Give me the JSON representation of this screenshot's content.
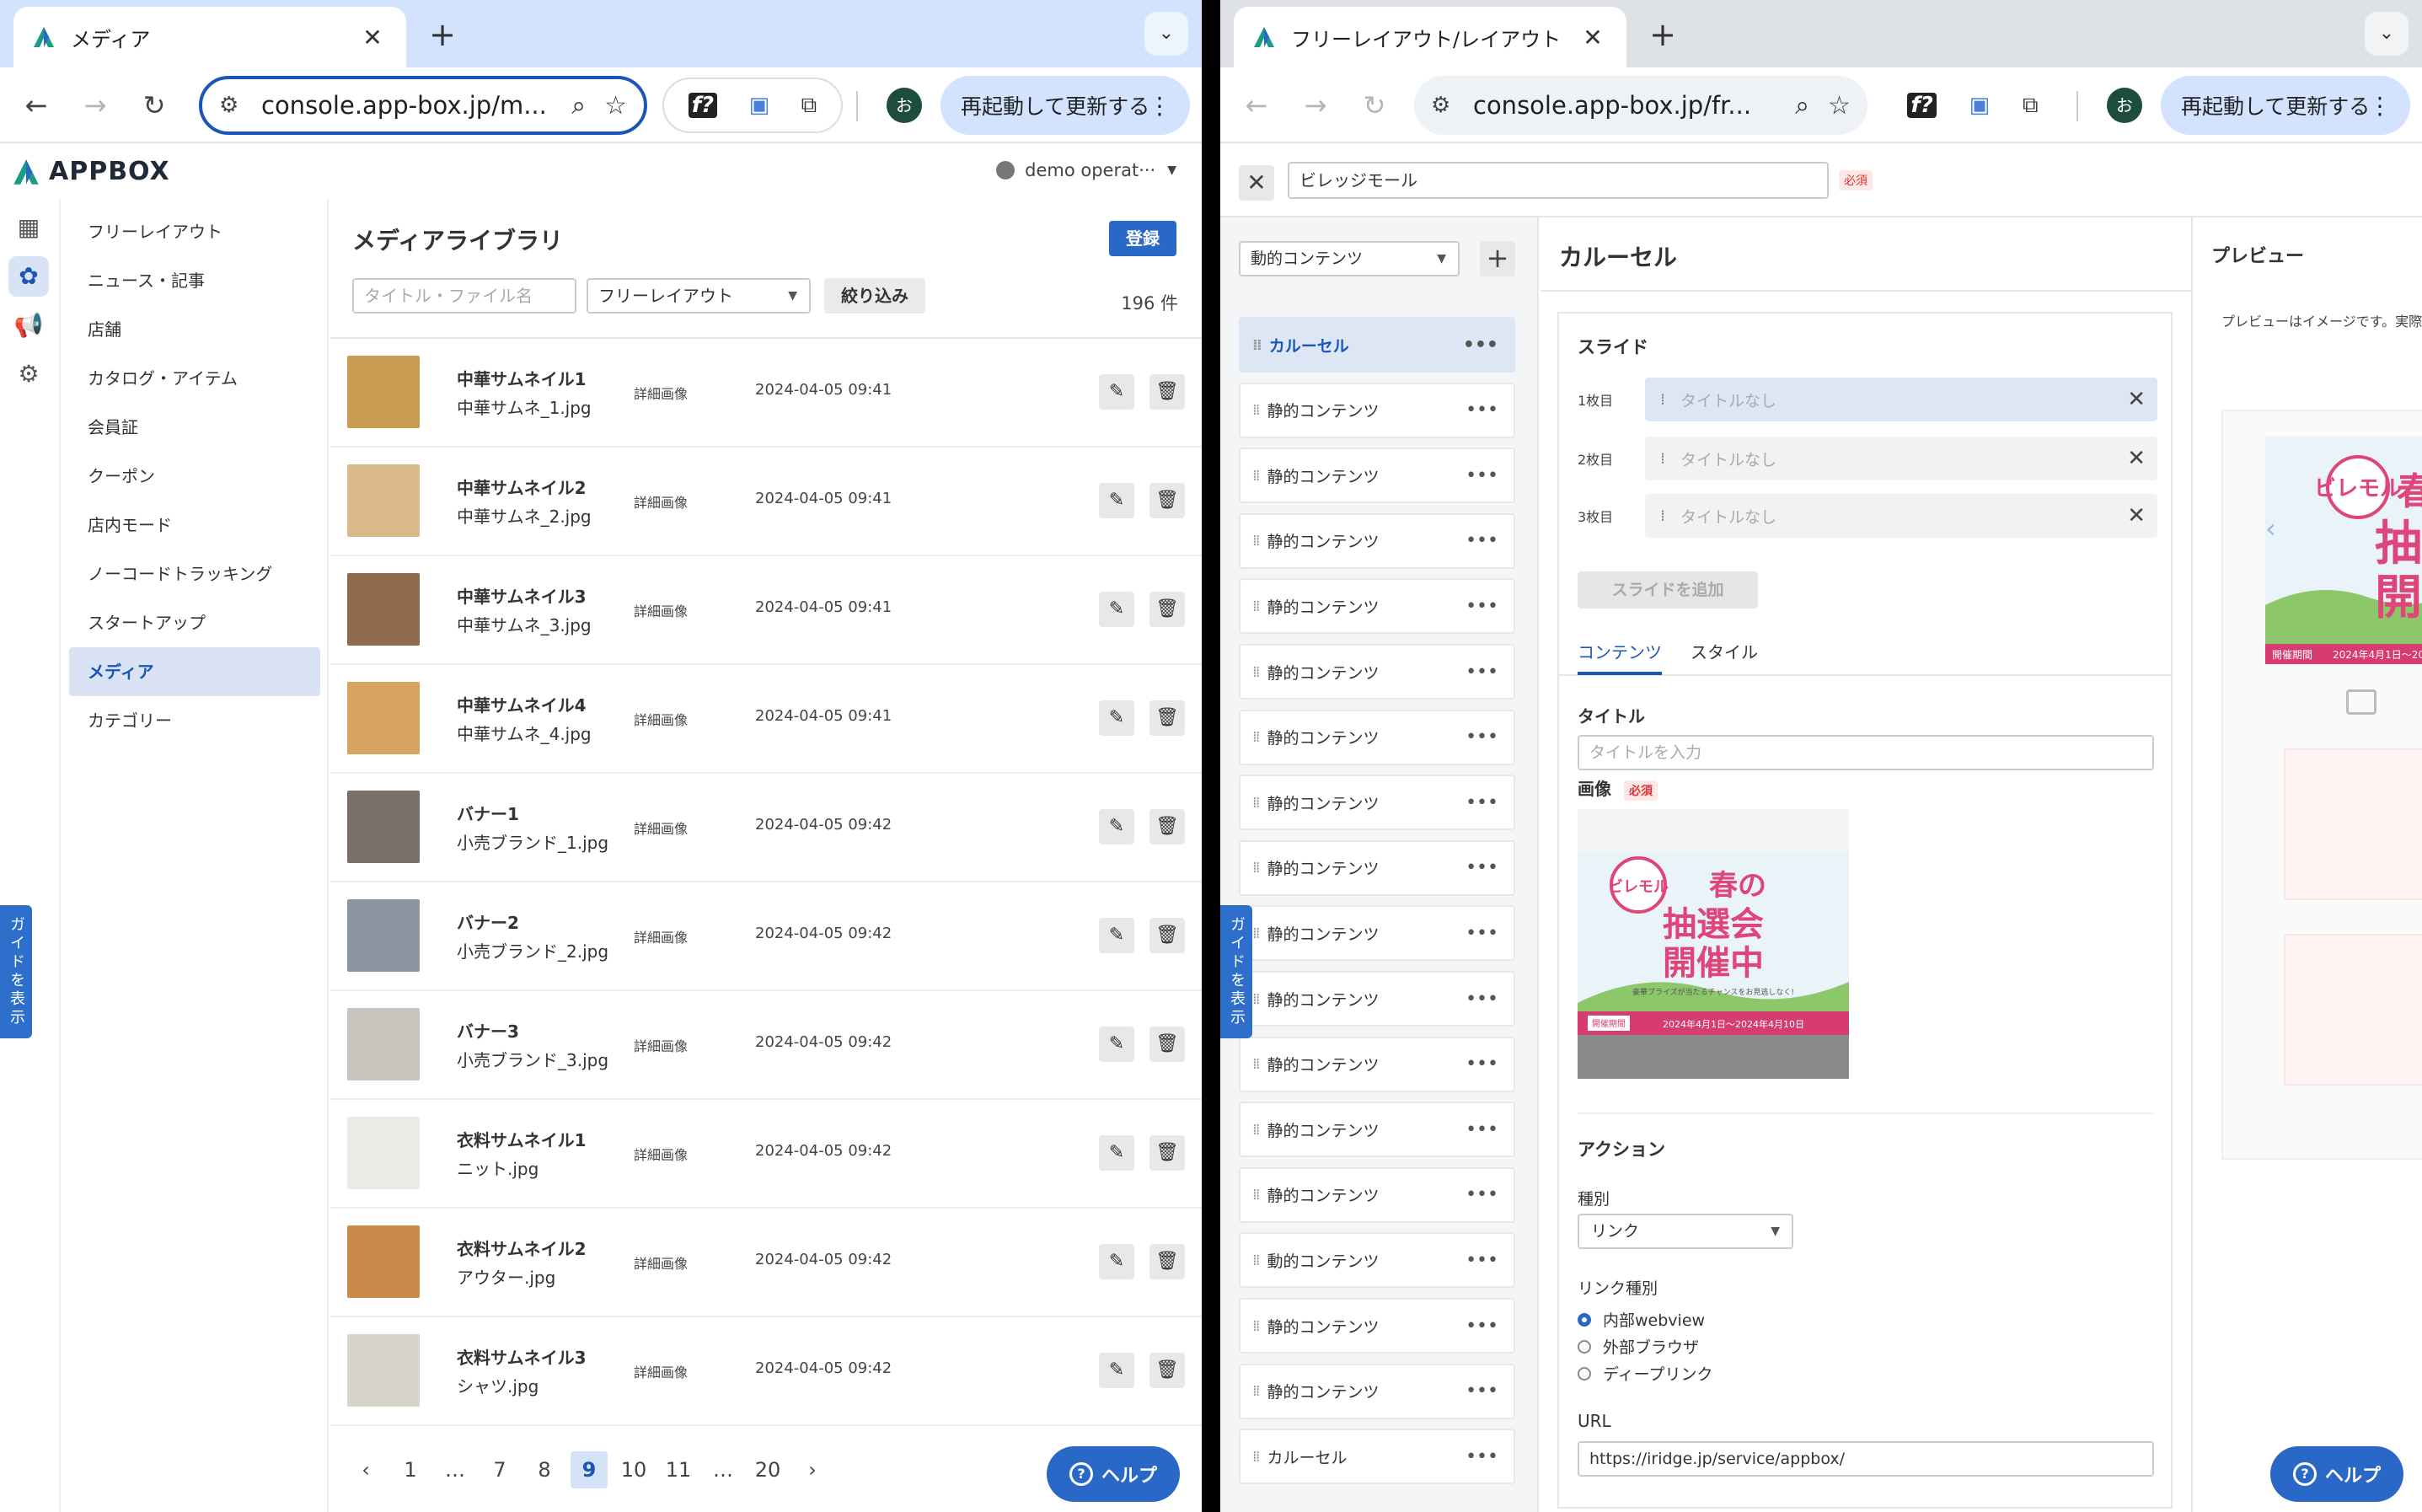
{
  "left": {
    "tab": {
      "title": "メディア"
    },
    "address": {
      "url": "console.app-box.jp/m..."
    },
    "relaunch_label": "再起動して更新する",
    "profile_initial": "お",
    "app": {
      "brand": "APPBOX",
      "user": "demo operat···",
      "rail_icons": [
        "dashboard-icon",
        "content-icon",
        "megaphone-icon",
        "gear-icon"
      ],
      "nav": [
        {
          "label": "フリーレイアウト"
        },
        {
          "label": "ニュース・記事"
        },
        {
          "label": "店舗"
        },
        {
          "label": "カタログ・アイテム"
        },
        {
          "label": "会員証"
        },
        {
          "label": "クーポン"
        },
        {
          "label": "店内モード"
        },
        {
          "label": "ノーコードトラッキング"
        },
        {
          "label": "スタートアップ"
        },
        {
          "label": "メディア",
          "active": true
        },
        {
          "label": "カテゴリー"
        }
      ],
      "guide_label": "ガイドを表示",
      "page_title": "メディアライブラリ",
      "register_label": "登録",
      "search_placeholder": "タイトル・ファイル名",
      "filter_value": "フリーレイアウト",
      "filter_button": "絞り込み",
      "count": "196 件",
      "rows": [
        {
          "name": "中華サムネイル1",
          "file": "中華サムネ_1.jpg",
          "type": "詳細画像",
          "date": "2024-04-05 09:41",
          "thumb": "#c89a52"
        },
        {
          "name": "中華サムネイル2",
          "file": "中華サムネ_2.jpg",
          "type": "詳細画像",
          "date": "2024-04-05 09:41",
          "thumb": "#d9b98a"
        },
        {
          "name": "中華サムネイル3",
          "file": "中華サムネ_3.jpg",
          "type": "詳細画像",
          "date": "2024-04-05 09:41",
          "thumb": "#8c6a4a"
        },
        {
          "name": "中華サムネイル4",
          "file": "中華サムネ_4.jpg",
          "type": "詳細画像",
          "date": "2024-04-05 09:41",
          "thumb": "#d6a460"
        },
        {
          "name": "バナー1",
          "file": "小売ブランド_1.jpg",
          "type": "詳細画像",
          "date": "2024-04-05 09:42",
          "thumb": "#7a6e68"
        },
        {
          "name": "バナー2",
          "file": "小売ブランド_2.jpg",
          "type": "詳細画像",
          "date": "2024-04-05 09:42",
          "thumb": "#8c96a0"
        },
        {
          "name": "バナー3",
          "file": "小売ブランド_3.jpg",
          "type": "詳細画像",
          "date": "2024-04-05 09:42",
          "thumb": "#c7c3bd"
        },
        {
          "name": "衣料サムネイル1",
          "file": "ニット.jpg",
          "type": "詳細画像",
          "date": "2024-04-05 09:42",
          "thumb": "#eceae6"
        },
        {
          "name": "衣料サムネイル2",
          "file": "アウター.jpg",
          "type": "詳細画像",
          "date": "2024-04-05 09:42",
          "thumb": "#c98a4c"
        },
        {
          "name": "衣料サムネイル3",
          "file": "シャツ.jpg",
          "type": "詳細画像",
          "date": "2024-04-05 09:42",
          "thumb": "#d8d4cc"
        }
      ],
      "pagination": [
        "1",
        "…",
        "7",
        "8",
        "9",
        "10",
        "11",
        "…",
        "20"
      ],
      "current_page": "9",
      "help_label": "ヘルプ"
    }
  },
  "right": {
    "tab": {
      "title": "フリーレイアウト/レイアウト"
    },
    "address": {
      "url": "console.app-box.jp/fr..."
    },
    "relaunch_label": "再起動して更新する",
    "profile_initial": "お",
    "layout_name": "ビレッジモール",
    "required_label": "必須",
    "component_select": "動的コンテンツ",
    "components": [
      {
        "label": "カルーセル",
        "active": true
      },
      {
        "label": "静的コンテンツ"
      },
      {
        "label": "静的コンテンツ"
      },
      {
        "label": "静的コンテンツ"
      },
      {
        "label": "静的コンテンツ"
      },
      {
        "label": "静的コンテンツ"
      },
      {
        "label": "静的コンテンツ"
      },
      {
        "label": "静的コンテンツ"
      },
      {
        "label": "静的コンテンツ"
      },
      {
        "label": "静的コンテンツ"
      },
      {
        "label": "静的コンテンツ"
      },
      {
        "label": "静的コンテンツ"
      },
      {
        "label": "静的コンテンツ"
      },
      {
        "label": "静的コンテンツ"
      },
      {
        "label": "動的コンテンツ"
      },
      {
        "label": "静的コンテンツ"
      },
      {
        "label": "静的コンテンツ"
      },
      {
        "label": "カルーセル"
      }
    ],
    "guide_label": "ガイドを表示",
    "form": {
      "title": "カルーセル",
      "slides_label": "スライド",
      "slides": [
        {
          "no": "1枚目",
          "title": "タイトルなし"
        },
        {
          "no": "2枚目",
          "title": "タイトルなし"
        },
        {
          "no": "3枚目",
          "title": "タイトルなし"
        }
      ],
      "add_slide": "スライドを追加",
      "tabs": [
        "コンテンツ",
        "スタイル"
      ],
      "title_label": "タイトル",
      "title_placeholder": "タイトルを入力",
      "image_label": "画像",
      "banner": {
        "brand": "ビレモル",
        "line1": "春の",
        "line2": "抽選会",
        "line3": "開催中",
        "sub": "豪華プライズが当たるチャンスをお見逃しなく!",
        "period_label": "開催期間",
        "period": "2024年4月1日〜2024年4月10日"
      },
      "action_label": "アクション",
      "kind_label": "種別",
      "kind_value": "リンク",
      "link_kind_label": "リンク種別",
      "link_options": [
        {
          "label": "内部webview",
          "checked": true
        },
        {
          "label": "外部ブラウザ"
        },
        {
          "label": "ディープリンク"
        }
      ],
      "url_label": "URL",
      "url_value": "https://iridge.jp/service/appbox/"
    },
    "preview": {
      "title": "プレビュー",
      "note": "プレビューはイメージです。実際の"
    },
    "help_label": "ヘルプ"
  }
}
